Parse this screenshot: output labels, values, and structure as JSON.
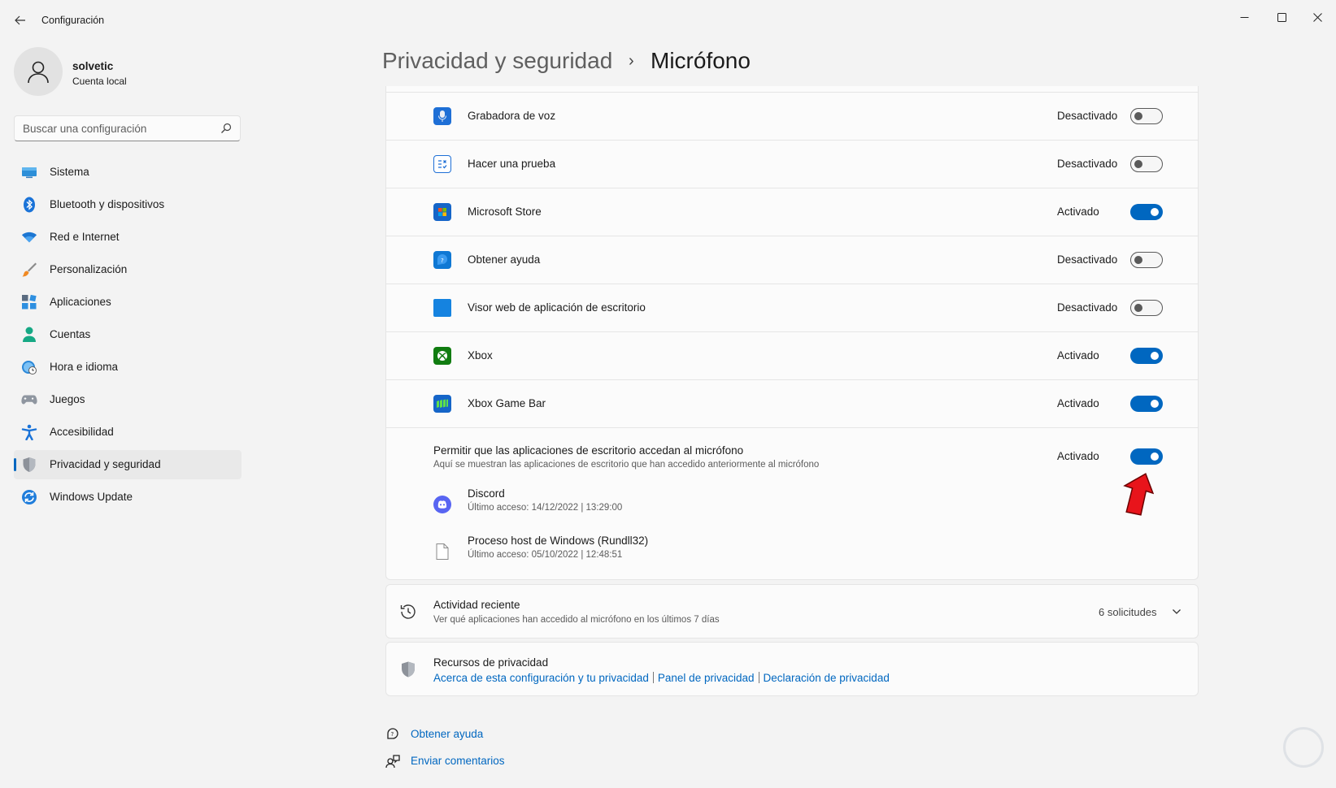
{
  "window": {
    "title": "Configuración",
    "controls": [
      "minimize-icon",
      "maximize-icon",
      "close-icon"
    ]
  },
  "user": {
    "name": "solvetic",
    "account_type": "Cuenta local"
  },
  "search": {
    "placeholder": "Buscar una configuración",
    "value": ""
  },
  "sidebar": {
    "items": [
      {
        "label": "Sistema",
        "icon": "monitor-icon"
      },
      {
        "label": "Bluetooth y dispositivos",
        "icon": "bluetooth-icon"
      },
      {
        "label": "Red e Internet",
        "icon": "wifi-icon"
      },
      {
        "label": "Personalización",
        "icon": "brush-icon"
      },
      {
        "label": "Aplicaciones",
        "icon": "apps-icon"
      },
      {
        "label": "Cuentas",
        "icon": "person-icon"
      },
      {
        "label": "Hora e idioma",
        "icon": "globe-clock-icon"
      },
      {
        "label": "Juegos",
        "icon": "gamepad-icon"
      },
      {
        "label": "Accesibilidad",
        "icon": "accessibility-icon"
      },
      {
        "label": "Privacidad y seguridad",
        "icon": "shield-icon",
        "active": true
      },
      {
        "label": "Windows Update",
        "icon": "update-icon"
      }
    ]
  },
  "breadcrumb": {
    "parent": "Privacidad y seguridad",
    "separator": "›",
    "current": "Micrófono"
  },
  "apps": [
    {
      "name": "Grabadora de voz",
      "state": "Desactivado",
      "on": false,
      "icon": "voice-recorder-icon"
    },
    {
      "name": "Hacer una prueba",
      "state": "Desactivado",
      "on": false,
      "icon": "quiz-icon"
    },
    {
      "name": "Microsoft Store",
      "state": "Activado",
      "on": true,
      "icon": "store-icon"
    },
    {
      "name": "Obtener ayuda",
      "state": "Desactivado",
      "on": false,
      "icon": "help-icon"
    },
    {
      "name": "Visor web de aplicación de escritorio",
      "state": "Desactivado",
      "on": false,
      "icon": "webview-icon"
    },
    {
      "name": "Xbox",
      "state": "Activado",
      "on": true,
      "icon": "xbox-icon"
    },
    {
      "name": "Xbox Game Bar",
      "state": "Activado",
      "on": true,
      "icon": "game-bar-icon"
    }
  ],
  "desktop_apps": {
    "title": "Permitir que las aplicaciones de escritorio accedan al micrófono",
    "subtitle": "Aquí se muestran las aplicaciones de escritorio que han accedido anteriormente al micrófono",
    "state": "Activado",
    "on": true,
    "items": [
      {
        "name": "Discord",
        "detail": "Último acceso: 14/12/2022  |  13:29:00",
        "icon": "discord-icon"
      },
      {
        "name": "Proceso host de Windows (Rundll32)",
        "detail": "Último acceso: 05/10/2022  |  12:48:51",
        "icon": "file-icon"
      }
    ]
  },
  "recent_activity": {
    "title": "Actividad reciente",
    "subtitle": "Ver qué aplicaciones han accedido al micrófono en los últimos 7 días",
    "count": "6 solicitudes"
  },
  "privacy_resources": {
    "title": "Recursos de privacidad",
    "links": [
      "Acerca de esta configuración y tu privacidad",
      "Panel de privacidad",
      "Declaración de privacidad"
    ]
  },
  "footer": {
    "help": "Obtener ayuda",
    "feedback": "Enviar comentarios"
  },
  "colors": {
    "accent": "#0067c0",
    "background": "#f3f3f3",
    "card": "#fbfbfb",
    "annotation_arrow": "#e8141b"
  }
}
